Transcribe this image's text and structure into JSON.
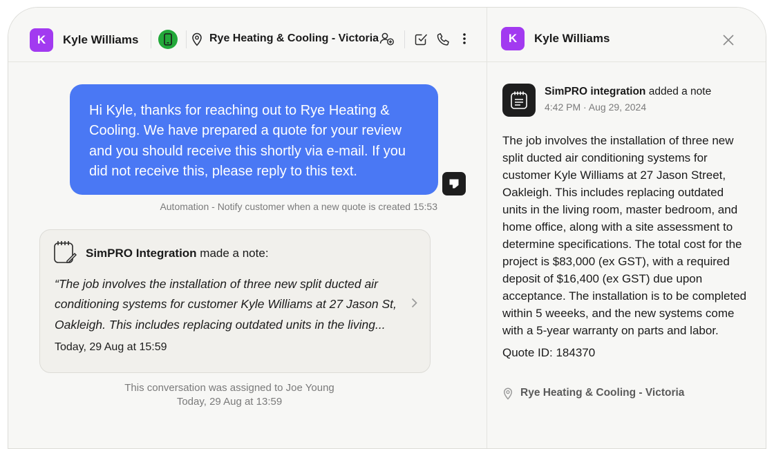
{
  "conversation": {
    "contact": {
      "avatar_letter": "K",
      "name": "Kyle Williams"
    },
    "location": "Rye Heating & Cooling - Victoria",
    "icons": [
      "phone-status-icon",
      "location-pin-icon",
      "assign-user-icon",
      "checkbox-icon",
      "phone-icon",
      "more-vertical-icon"
    ]
  },
  "messages": {
    "outbound": {
      "text": "Hi Kyle, thanks for reaching out to Rye Heating & Cooling. We have prepared a quote for your review and you should receive this shortly via e-mail. If you did not receive this, please reply to this text.",
      "meta": "Automation - Notify customer when a new quote is created 15:53"
    },
    "note": {
      "author": "SimPRO Integration",
      "action": " made a note:",
      "quote": "“The job involves the installation of three new split ducted air conditioning systems for customer Kyle Williams at 27 Jason St, Oakleigh. This includes replacing outdated units in the living...",
      "time": "Today, 29 Aug at 15:59"
    },
    "assignment": {
      "text": "This conversation was assigned to Joe Young",
      "time": "Today, 29 Aug at 13:59"
    }
  },
  "detail_panel": {
    "contact": {
      "avatar_letter": "K",
      "name": "Kyle Williams"
    },
    "note": {
      "actor": "SimPRO integration",
      "action": " added a note",
      "timestamp": "4:42 PM · Aug 29, 2024",
      "body": "The job involves the installation of three new split ducted air conditioning systems for customer Kyle Williams at 27 Jason Street, Oakleigh. This includes replacing outdated units in the living room, master bedroom, and home office, along with a site assessment to determine specifications. The total cost for the project is $83,000 (ex GST), with a required deposit of $16,400 (ex GST) due upon acceptance. The installation is to be completed within 5 weeeks, and the new systems come with a 5-year warranty on parts and labor.",
      "quote_id": "Quote ID: 184370",
      "location": "Rye Heating & Cooling - Victoria"
    }
  },
  "colors": {
    "avatar": "#a23af0",
    "bubble": "#4a78f4",
    "status_green": "#23a93a",
    "dark_badge": "#1e1e1e",
    "pane_bg": "#f7f7f5"
  }
}
